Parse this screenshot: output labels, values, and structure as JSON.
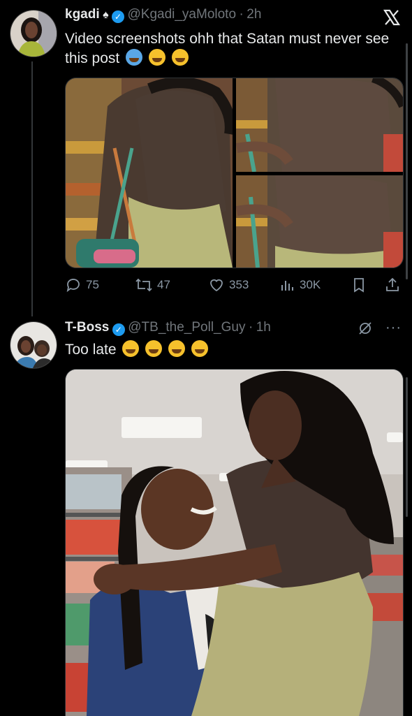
{
  "tweet1": {
    "display_name": "kgadi",
    "handle": "@Kgadi_yaMoloto",
    "time": "2h",
    "text": "Video screenshots ohh that Satan must never see this post",
    "emojis": [
      "loudly-crying-face",
      "face-with-tears-of-joy",
      "pleading-face"
    ],
    "close_glyph": "X",
    "actions": {
      "replies": "75",
      "reposts": "47",
      "likes": "353",
      "views": "30K"
    }
  },
  "tweet2": {
    "display_name": "T-Boss",
    "handle": "@TB_the_Poll_Guy",
    "time": "1h",
    "text": "Too late",
    "emojis": [
      "rolling-on-the-floor-laughing",
      "face-with-tears-of-joy",
      "face-with-tears-of-joy",
      "face-with-tears-of-joy"
    ]
  },
  "separator": "·",
  "colors": {
    "background": "#000000",
    "text": "#e7e9ea",
    "muted": "#71767b",
    "verified": "#1d9bf0",
    "divider": "#333639"
  }
}
